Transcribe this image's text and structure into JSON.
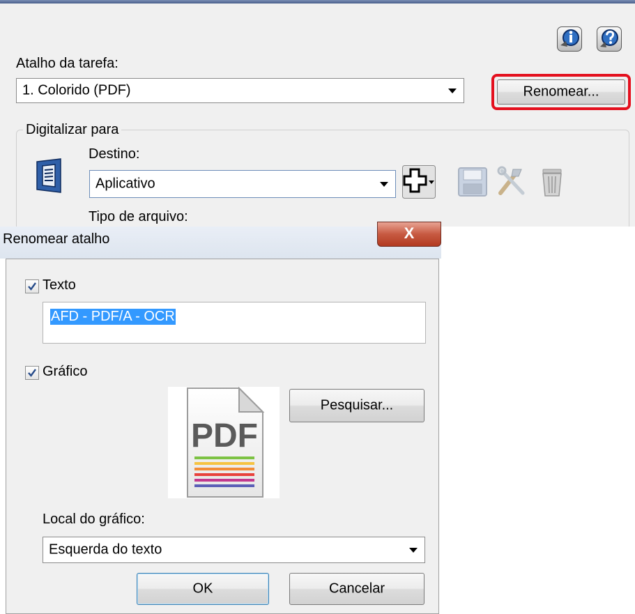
{
  "top": {
    "task_label": "Atalho da tarefa:",
    "task_value": "1. Colorido (PDF)",
    "rename_label": "Renomear...",
    "highlight_color": "#e4101e",
    "scan_group_label": "Digitalizar para",
    "destination_label": "Destino:",
    "destination_value": "Aplicativo",
    "file_type_label": "Tipo de arquivo:",
    "icons": [
      "info-icon",
      "help-icon",
      "application-icon",
      "add-icon",
      "save-icon",
      "tools-icon",
      "trash-icon"
    ]
  },
  "dialog": {
    "title": "Renomear atalho",
    "close_label": "X",
    "text_checkbox_label": "Texto",
    "text_checked": true,
    "text_value": "AFD - PDF/A - OCR",
    "graphic_checkbox_label": "Gráfico",
    "graphic_checked": true,
    "graphic_text": "PDF",
    "search_label": "Pesquisar...",
    "location_label": "Local do gráfico:",
    "location_value": "Esquerda do texto",
    "ok_label": "OK",
    "cancel_label": "Cancelar"
  }
}
